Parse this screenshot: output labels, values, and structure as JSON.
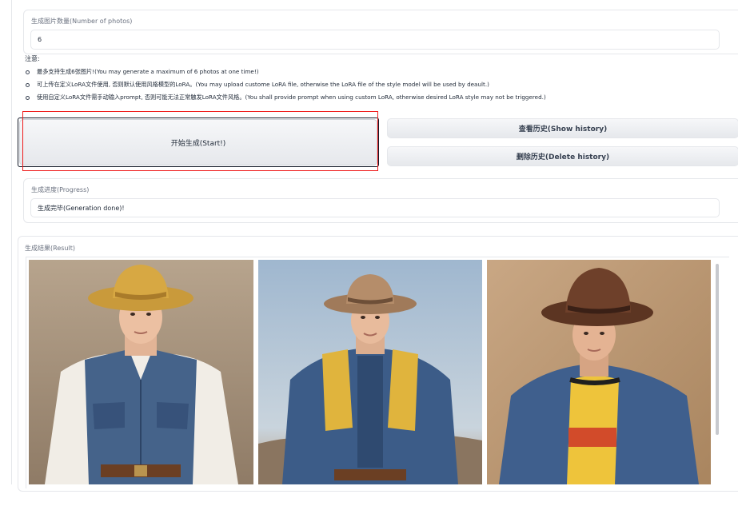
{
  "num_photos": {
    "label": "生成图片数量(Number of photos)",
    "value": "6"
  },
  "notes": {
    "title": "注意:",
    "items": [
      "最多支持生成6张图片!(You may generate a maximum of 6 photos at one time!)",
      "可上传在定义LoRA文件使用, 否则默认使用风格模型的LoRA。(You may upload custome LoRA file, otherwise the LoRA file of the style model will be used by deault.)",
      "使用自定义LoRA文件需手动输入prompt, 否则可能无法正常触发LoRA文件风格。(You shall provide prompt when using custom LoRA, otherwise desired LoRA style may not be triggered.)"
    ]
  },
  "buttons": {
    "start": "开始生成(Start!)",
    "show_history": "查看历史(Show history)",
    "delete_history": "删除历史(Delete history)"
  },
  "progress": {
    "label": "生成进度(Progress)",
    "value": "生成完毕(Generation done)!"
  },
  "result": {
    "label": "生成结果(Result)"
  },
  "colors": {
    "highlight_red": "#ef1c1c",
    "focus_ring": "#111827",
    "border": "#e5e7eb"
  }
}
